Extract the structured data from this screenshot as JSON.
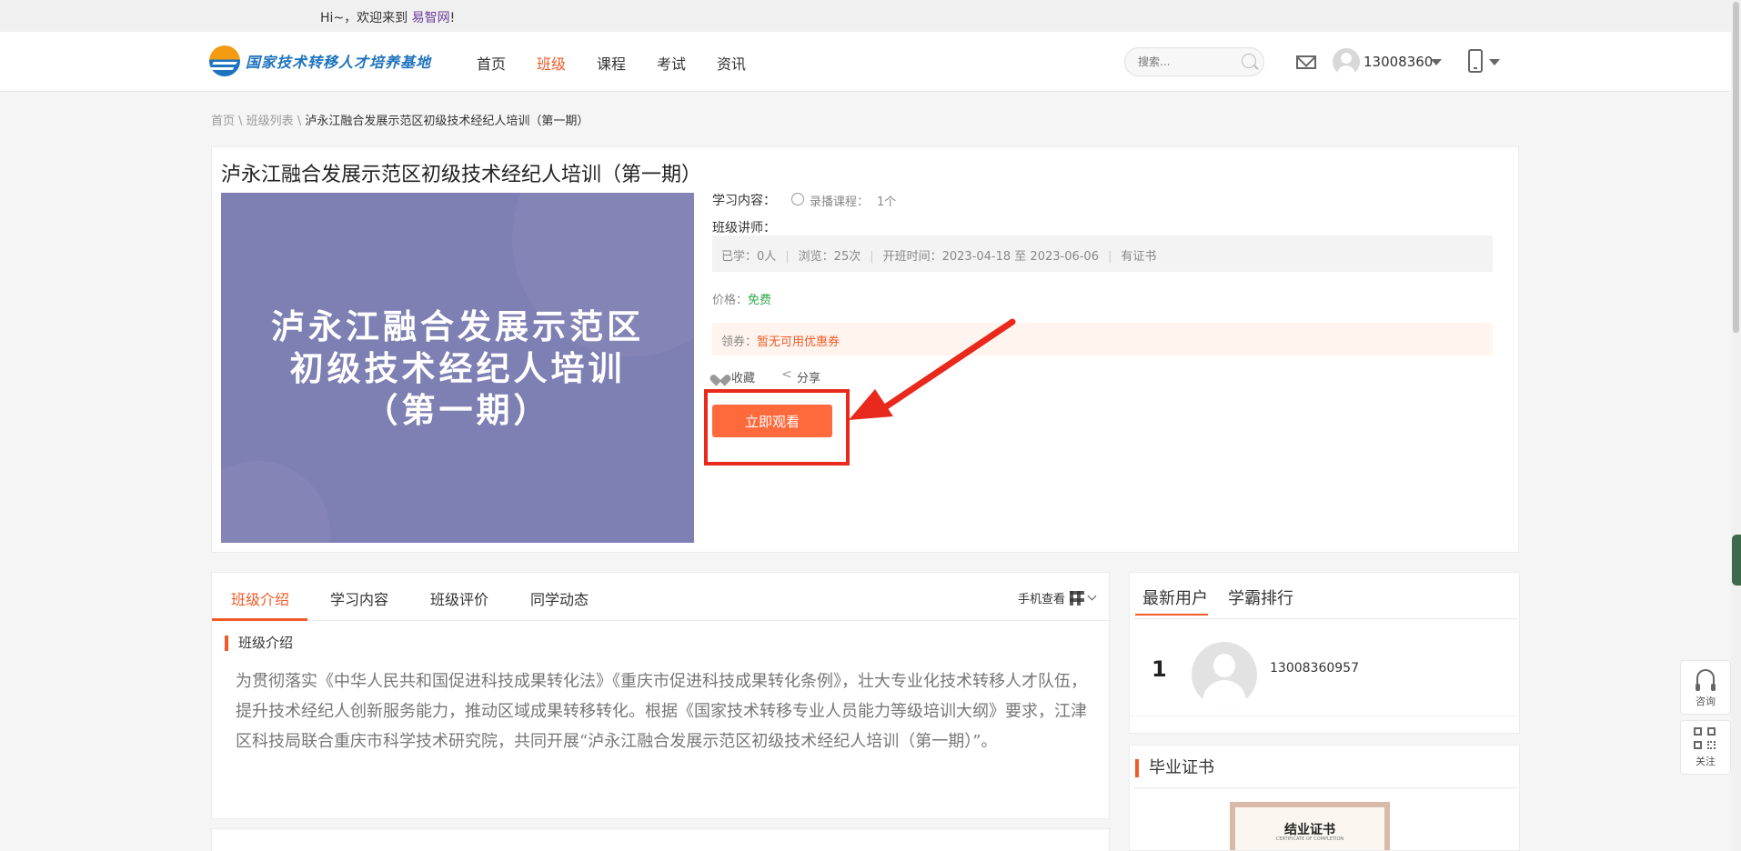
{
  "greeting": {
    "prefix": "Hi~，欢迎来到 ",
    "site": "易智网",
    "suffix": "!"
  },
  "header": {
    "logo_text": "国家技术转移人才培养基地",
    "nav": [
      "首页",
      "班级",
      "课程",
      "考试",
      "资讯"
    ],
    "nav_active": 1,
    "search_placeholder": "搜索...",
    "username": "13008360"
  },
  "breadcrumb": {
    "home": "首页",
    "list": "班级列表",
    "current": "泸永江融合发展示范区初级技术经纪人培训（第一期）",
    "sep": " \\ "
  },
  "course": {
    "title": "泸永江融合发展示范区初级技术经纪人培训（第一期）",
    "cover_lines": [
      "泸永江融合发展示范区",
      "初级技术经纪人培训",
      "（第一期）"
    ],
    "content_label": "学习内容：",
    "recorded_label": "录播课程：",
    "recorded_count": "1个",
    "teacher_label": "班级讲师：",
    "stats": {
      "learned": "已学：0人",
      "views": "浏览：25次",
      "time": "开班时间：2023-04-18 至 2023-06-06",
      "cert": "有证书"
    },
    "price_label": "价格：",
    "price_value": "免费",
    "coupon_label": "领券：",
    "coupon_value": "暂无可用优惠券",
    "favorite_label": "收藏",
    "share_label": "分享",
    "watch_button": "立即观看"
  },
  "tabs": {
    "items": [
      "班级介绍",
      "学习内容",
      "班级评价",
      "同学动态"
    ],
    "active": 0,
    "mobile_view": "手机查看",
    "section_heading": "班级介绍",
    "intro": "为贯彻落实《中华人民共和国促进科技成果转化法》《重庆市促进科技成果转化条例》，壮大专业化技术转移人才队伍，提升技术经纪人创新服务能力，推动区域成果转移转化。根据《国家技术转移专业人员能力等级培训大纲》要求，江津区科技局联合重庆市科学技术研究院，共同开展“泸永江融合发展示范区初级技术经纪人培训（第一期）”。"
  },
  "users": {
    "tabs": [
      "最新用户",
      "学霸排行"
    ],
    "rank": "1",
    "phone": "13008360957"
  },
  "certificate": {
    "heading": "毕业证书",
    "title": "结业证书",
    "subtitle": "CERTIFICATE OF COMPLETION"
  },
  "float_bar": {
    "consult": "咨询",
    "follow": "关注"
  },
  "colors": {
    "accent": "#f05a28",
    "free": "#2eaa4a",
    "button": "#ff6a3d",
    "highlight": "#e8291b",
    "cover": "#7e7fb3"
  }
}
